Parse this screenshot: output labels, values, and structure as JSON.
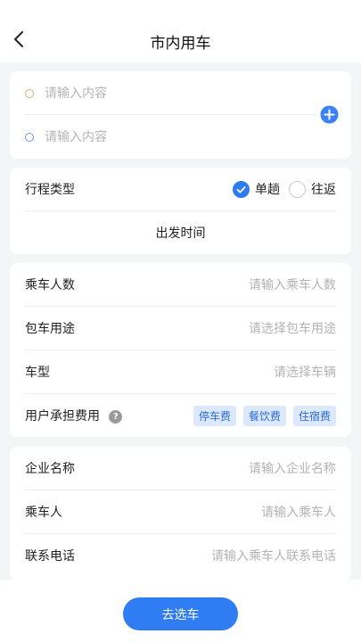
{
  "header": {
    "title": "市内用车",
    "back_icon": "chevron-left-icon"
  },
  "address": {
    "start_placeholder": "请输入内容",
    "end_placeholder": "请输入内容",
    "add_icon": "plus-circle-icon",
    "add_color": "#3b82f6"
  },
  "trip": {
    "label": "行程类型",
    "options": [
      {
        "label": "单趟",
        "checked": true
      },
      {
        "label": "往返",
        "checked": false
      }
    ],
    "depart_time": "出发时间"
  },
  "info": {
    "passengers": {
      "label": "乘车人数",
      "placeholder": "请输入乘车人数"
    },
    "purpose": {
      "label": "包车用途",
      "placeholder": "请选择包车用途"
    },
    "car_type": {
      "label": "车型",
      "placeholder": "请选择车辆"
    },
    "fee": {
      "label": "用户承担费用",
      "help": "?",
      "tags": [
        "停车费",
        "餐饮费",
        "住宿费"
      ]
    }
  },
  "company": {
    "name": {
      "label": "企业名称",
      "placeholder": "请输入企业名称"
    },
    "passenger": {
      "label": "乘车人",
      "placeholder": "请输入乘车人"
    },
    "phone": {
      "label": "联系电话",
      "placeholder": "请输入乘车人联系电话"
    }
  },
  "footer": {
    "button_label": "去选车",
    "accent": "#2f7cf3"
  }
}
